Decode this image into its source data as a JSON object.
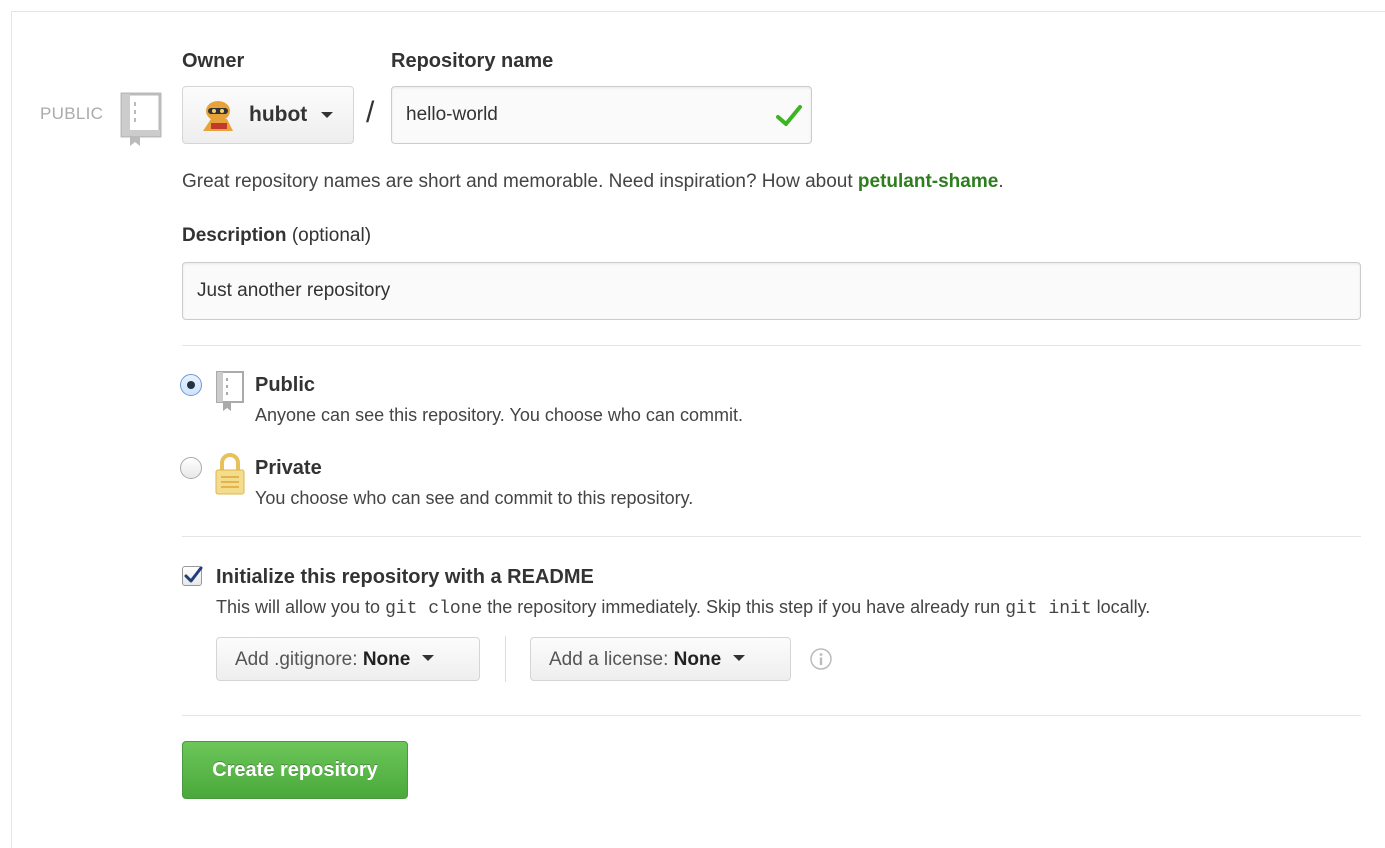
{
  "header": {
    "visibility_tag": "PUBLIC",
    "owner_label": "Owner",
    "repo_name_label": "Repository name",
    "slash": "/"
  },
  "owner": {
    "name": "hubot"
  },
  "repo_name": {
    "value": "hello-world"
  },
  "hint": {
    "text": "Great repository names are short and memorable. Need inspiration? How about ",
    "suggestion": "petulant-shame",
    "end": "."
  },
  "description": {
    "label": "Description",
    "optional": "(optional)",
    "value": "Just another repository"
  },
  "visibility": {
    "public": {
      "title": "Public",
      "desc": "Anyone can see this repository. You choose who can commit.",
      "selected": true
    },
    "private": {
      "title": "Private",
      "desc": "You choose who can see and commit to this repository.",
      "selected": false
    }
  },
  "readme": {
    "checked": true,
    "title": "Initialize this repository with a README",
    "desc_1": "This will allow you to ",
    "code_1": "git clone",
    "desc_2": " the repository immediately. Skip this step if you have already run ",
    "code_2": "git init",
    "desc_3": " locally."
  },
  "gitignore": {
    "label": "Add .gitignore: ",
    "value": "None"
  },
  "license": {
    "label": "Add a license: ",
    "value": "None"
  },
  "actions": {
    "create": "Create repository"
  },
  "colors": {
    "accent_green": "#4aa93a",
    "suggestion_green": "#2e7d1f",
    "check_green": "#3cb521",
    "lock_gold": "#e8c15a"
  },
  "icons": [
    "repo-icon",
    "owner-avatar",
    "chevron-down-icon",
    "checkmark-icon",
    "lock-icon",
    "info-icon",
    "checkbox-check-icon"
  ]
}
